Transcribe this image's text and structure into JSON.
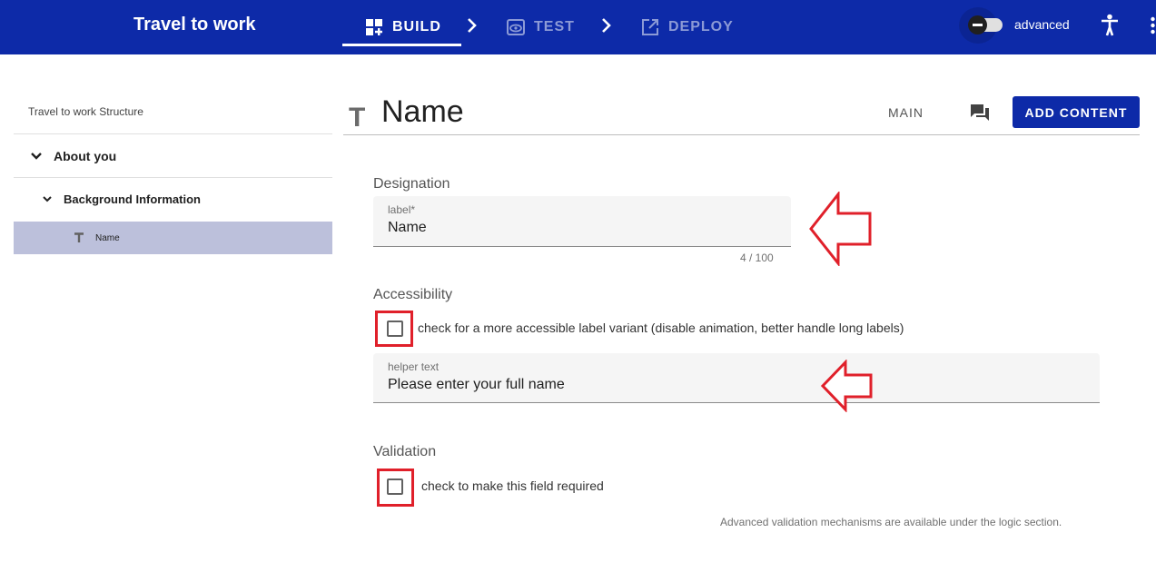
{
  "app": {
    "title": "Travel to work"
  },
  "steps": [
    {
      "label": "BUILD",
      "icon": "build-icon",
      "active": true
    },
    {
      "label": "TEST",
      "icon": "eye-icon",
      "active": false
    },
    {
      "label": "DEPLOY",
      "icon": "open-in-new-icon",
      "active": false
    }
  ],
  "header": {
    "advanced_label": "advanced"
  },
  "sidebar": {
    "title": "Travel to work Structure",
    "items": [
      {
        "label": "About you",
        "icon": "chevron-down-icon"
      },
      {
        "label": "Background Information",
        "icon": "chevron-down-icon"
      },
      {
        "label": "Name",
        "icon": "text-type-icon",
        "selected": true
      }
    ]
  },
  "main": {
    "title_icon": "T",
    "title": "Name",
    "tab_main": "MAIN",
    "add_content": "ADD CONTENT",
    "designation": {
      "title": "Designation",
      "label_caption": "label*",
      "label_value": "Name",
      "counter": "4 / 100"
    },
    "accessibility": {
      "title": "Accessibility",
      "checkbox_label": "check for a more accessible label variant (disable animation, better handle long labels)",
      "helper_caption": "helper text",
      "helper_value": "Please enter your full name"
    },
    "validation": {
      "title": "Validation",
      "checkbox_label": "check to make this field required",
      "hint": "Advanced validation mechanisms are available under the logic section."
    }
  },
  "colors": {
    "primary": "#0d2aa8",
    "selected_row": "#bcc0db",
    "annotation": "#e0202a"
  }
}
